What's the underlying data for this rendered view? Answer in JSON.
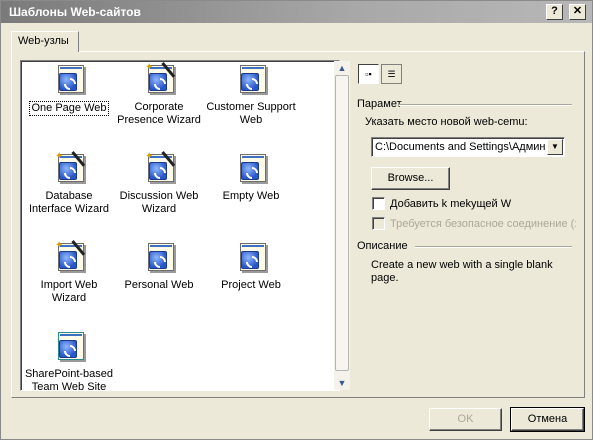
{
  "window": {
    "title": "Шаблоны Web-сайтов",
    "help_button": "?",
    "close_button": "✕"
  },
  "tab": {
    "label": "Web-узлы"
  },
  "templates": [
    {
      "label": "One Page Web",
      "icon": "web-page-icon"
    },
    {
      "label": "Corporate Presence Wizard",
      "icon": "wizard-icon"
    },
    {
      "label": "Customer Support Web",
      "icon": "web-page-icon"
    },
    {
      "label": "Database Interface Wizard",
      "icon": "wizard-icon"
    },
    {
      "label": "Discussion Web Wizard",
      "icon": "wizard-icon"
    },
    {
      "label": "Empty Web",
      "icon": "web-page-icon"
    },
    {
      "label": "Import Web Wizard",
      "icon": "wizard-icon"
    },
    {
      "label": "Personal Web",
      "icon": "web-page-icon"
    },
    {
      "label": "Project Web",
      "icon": "web-page-icon"
    },
    {
      "label": "SharePoint-based Team Web Site",
      "icon": "sharepoint-icon"
    }
  ],
  "view_buttons": {
    "large_icons": "large-icons-view-icon",
    "details": "details-view-icon"
  },
  "options": {
    "group_label": "Парамет",
    "location_label": "Указать место новой web-cemu:",
    "location_value": "C:\\Documents and Settings\\Админи",
    "browse_label": "Browse...",
    "add_to_current_label": "Добавить k mekущей W",
    "add_to_current_checked": false,
    "secure_connection_label": "Требуется безопасное соединение (:",
    "secure_connection_enabled": false
  },
  "description": {
    "group_label": "Описание",
    "text": "Create a new web with a single blank page."
  },
  "footer": {
    "ok_label": "OK",
    "cancel_label": "Отмена"
  }
}
